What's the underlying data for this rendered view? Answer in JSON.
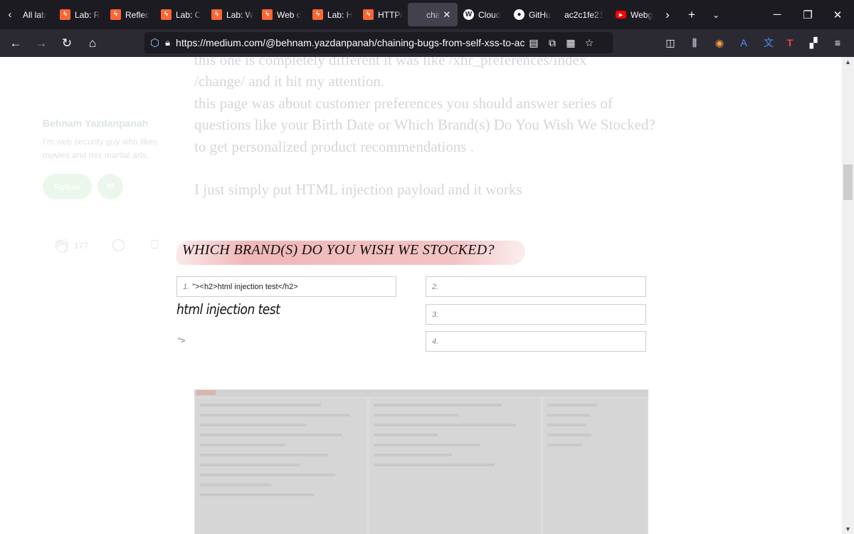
{
  "tabs": [
    {
      "label": "All lab",
      "favicon": "list-all-tabs-icon"
    },
    {
      "label": "Lab: R",
      "favicon": "lab-icon"
    },
    {
      "label": "Reflec",
      "favicon": "lab-icon"
    },
    {
      "label": "Lab: C",
      "favicon": "lab-icon"
    },
    {
      "label": "Lab: W",
      "favicon": "lab-icon"
    },
    {
      "label": "Web c",
      "favicon": "lab-icon"
    },
    {
      "label": "Lab: H",
      "favicon": "lab-icon"
    },
    {
      "label": "HTTP/",
      "favicon": "lab-icon"
    },
    {
      "label": "cha",
      "favicon": "none",
      "active": true
    },
    {
      "label": "Cloud",
      "favicon": "wordpress-icon"
    },
    {
      "label": "GitHu",
      "favicon": "github-icon"
    },
    {
      "label": "ac2c1fe21",
      "favicon": "none"
    },
    {
      "label": "Webg",
      "favicon": "youtube-icon"
    }
  ],
  "address_bar": {
    "url": "https://medium.com/@behnam.yazdanpanah/chaining-bugs-from-self-xss-to-account-takeover"
  },
  "article": {
    "line1": "this one is completely different it was like /xhr_preferences/index",
    "line2": "/change/ and it hit my attention.",
    "line3": "this page was about customer preferences you should answer series of",
    "line4": "questions like your Birth Date or Which Brand(s) Do You Wish We Stocked?",
    "line5": "to get personalized product recommendations .",
    "line6": "I just simply put HTML injection payload and it works"
  },
  "author": {
    "name": "Behnam Yazdanpanah",
    "bio": "I'm web security guy who likes movies and mix martial arts.",
    "follow_label": "Follow"
  },
  "actions": {
    "clap_count": "177"
  },
  "embedded_form": {
    "heading": "WHICH BRAND(S) DO YOU WISH WE STOCKED?",
    "field1_num": "1.",
    "field1_value": "\"><h2>html injection test</h2>",
    "field2_num": "2.",
    "field3_num": "3.",
    "field4_num": "4.",
    "injected_output": "html injection test",
    "stray_text": "\">"
  },
  "colors": {
    "tabbar_bg": "#1c1b22",
    "navbar_bg": "#2b2a33",
    "lab_favicon": "#ff6633",
    "brush_highlight": "#eba0a0"
  }
}
